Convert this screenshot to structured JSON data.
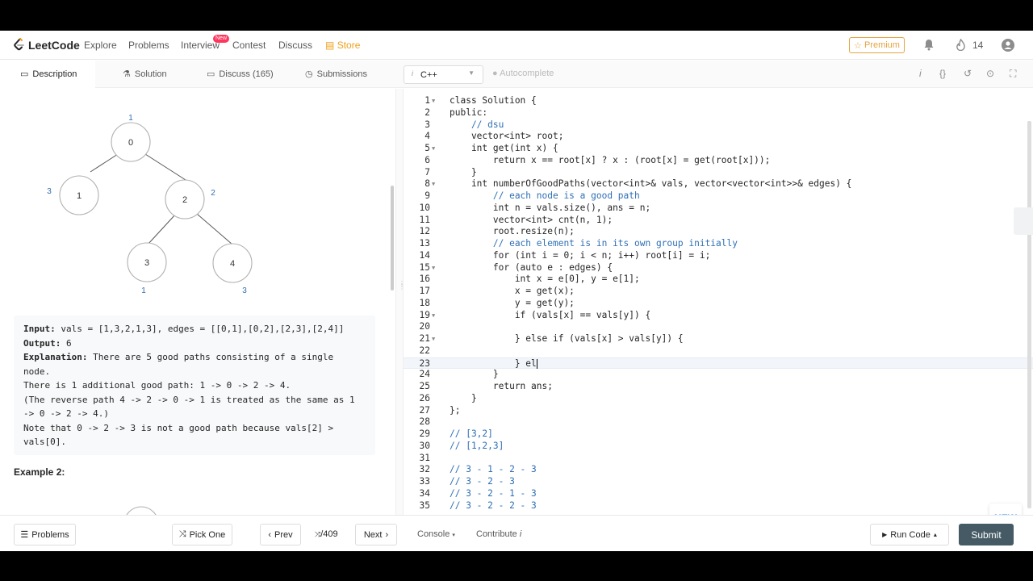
{
  "nav": {
    "brand": "LeetCode",
    "links": [
      "Explore",
      "Problems",
      "Interview",
      "Contest",
      "Discuss",
      "Store"
    ],
    "interview_badge": "New",
    "premium": "Premium",
    "streak": "14"
  },
  "tabs": {
    "description": "Description",
    "solution": "Solution",
    "discuss": "Discuss (165)",
    "submissions": "Submissions"
  },
  "editor_toolbar": {
    "language": "C++",
    "autocomplete": "Autocomplete"
  },
  "tree": {
    "nodes": [
      "0",
      "1",
      "2",
      "3",
      "4"
    ],
    "values": [
      "1",
      "3",
      "2",
      "1",
      "3"
    ]
  },
  "example1": {
    "input_label": "Input:",
    "input": " vals = [1,3,2,1,3], edges = [[0,1],[0,2],[2,3],[2,4]]",
    "output_label": "Output:",
    "output": " 6",
    "explanation_label": "Explanation:",
    "lines": [
      " There are 5 good paths consisting of a single",
      "node.",
      "There is 1 additional good path: 1 -> 0 -> 2 -> 4.",
      "(The reverse path 4 -> 2 -> 0 -> 1 is treated as the same as 1",
      "-> 0 -> 2 -> 4.)",
      "Note that 0 -> 2 -> 3 is not a good path because vals[2] >",
      "vals[0]."
    ]
  },
  "example2_title": "Example 2:",
  "code": [
    {
      "n": "1",
      "t": "class Solution {",
      "fold": true
    },
    {
      "n": "2",
      "t": "public:"
    },
    {
      "n": "3",
      "t": "    // dsu",
      "c": true
    },
    {
      "n": "4",
      "t": "    vector<int> root;"
    },
    {
      "n": "5",
      "t": "    int get(int x) {",
      "fold": true
    },
    {
      "n": "6",
      "t": "        return x == root[x] ? x : (root[x] = get(root[x]));"
    },
    {
      "n": "7",
      "t": "    }"
    },
    {
      "n": "8",
      "t": "    int numberOfGoodPaths(vector<int>& vals, vector<vector<int>>& edges) {",
      "fold": true
    },
    {
      "n": "9",
      "t": "        // each node is a good path",
      "c": true
    },
    {
      "n": "10",
      "t": "        int n = vals.size(), ans = n;"
    },
    {
      "n": "11",
      "t": "        vector<int> cnt(n, 1);"
    },
    {
      "n": "12",
      "t": "        root.resize(n);"
    },
    {
      "n": "13",
      "t": "        // each element is in its own group initially",
      "c": true
    },
    {
      "n": "14",
      "t": "        for (int i = 0; i < n; i++) root[i] = i;"
    },
    {
      "n": "15",
      "t": "        for (auto e : edges) {",
      "fold": true
    },
    {
      "n": "16",
      "t": "            int x = e[0], y = e[1];"
    },
    {
      "n": "17",
      "t": "            x = get(x);"
    },
    {
      "n": "18",
      "t": "            y = get(y);"
    },
    {
      "n": "19",
      "t": "            if (vals[x] == vals[y]) {",
      "fold": true
    },
    {
      "n": "20",
      "t": ""
    },
    {
      "n": "21",
      "t": "            } else if (vals[x] > vals[y]) {",
      "fold": true
    },
    {
      "n": "22",
      "t": ""
    },
    {
      "n": "23",
      "t": "            } el",
      "cur": true
    },
    {
      "n": "24",
      "t": "        }"
    },
    {
      "n": "25",
      "t": "        return ans;"
    },
    {
      "n": "26",
      "t": "    }"
    },
    {
      "n": "27",
      "t": "};"
    },
    {
      "n": "28",
      "t": ""
    },
    {
      "n": "29",
      "t": "// [3,2]",
      "c": true
    },
    {
      "n": "30",
      "t": "// [1,2,3]",
      "c": true
    },
    {
      "n": "31",
      "t": ""
    },
    {
      "n": "32",
      "t": "// 3 - 1 - 2 - 3",
      "c": true
    },
    {
      "n": "33",
      "t": "// 3 - 2 - 3",
      "c": true
    },
    {
      "n": "34",
      "t": "// 3 - 2 - 1 - 3",
      "c": true
    },
    {
      "n": "35",
      "t": "// 3 - 2 - 2 - 3",
      "c": true
    }
  ],
  "new_button": "NEW",
  "bottom": {
    "problems": "Problems",
    "pick_one": "Pick One",
    "prev": "Prev",
    "page": "/409",
    "next": "Next",
    "console": "Console",
    "contribute": "Contribute",
    "run_code": "Run Code",
    "submit": "Submit"
  }
}
